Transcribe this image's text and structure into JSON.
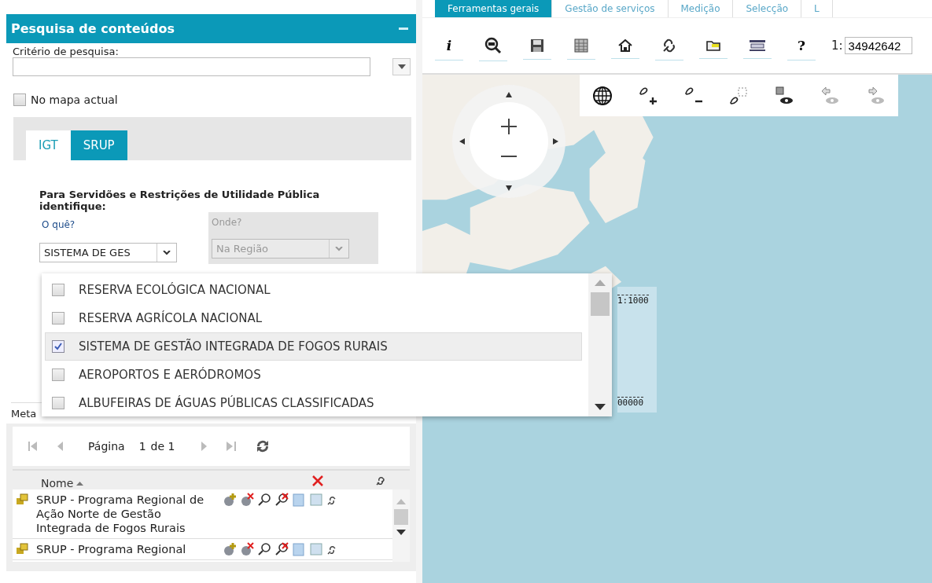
{
  "top_tabs": [
    {
      "label": "Ferramentas gerais",
      "selected": true
    },
    {
      "label": "Gestão de serviços",
      "selected": false
    },
    {
      "label": "Medição",
      "selected": false
    },
    {
      "label": "Selecção",
      "selected": false
    },
    {
      "label": "L",
      "selected": false
    }
  ],
  "map_toolbar": {
    "info_label": "i",
    "help_label": "?",
    "scale_prefix": "1:",
    "scale_value": "34942642"
  },
  "map": {
    "kind": "picture",
    "scale_labels": [
      "1:1000",
      "00000"
    ]
  },
  "search_panel": {
    "title": "Pesquisa de conteúdos",
    "criteria_label": "Critério de pesquisa:",
    "current_map": {
      "label": "No mapa actual",
      "checked": false
    },
    "tabs": [
      {
        "label": "IGT",
        "selected": false
      },
      {
        "label": "SRUP",
        "selected": true
      }
    ],
    "prompt": "Para Servidões e Restrições de Utilidade Pública identifique:",
    "what": {
      "label": "O quê?",
      "value": "SISTEMA DE GES"
    },
    "where": {
      "label": "Onde?",
      "value": "Na Região",
      "disabled": true
    },
    "metadata_label": "Meta"
  },
  "dropdown": {
    "options": [
      {
        "label": "RESERVA ECOLÓGICA NACIONAL",
        "checked": false,
        "selected": false
      },
      {
        "label": "RESERVA AGRÍCOLA NACIONAL",
        "checked": false,
        "selected": false
      },
      {
        "label": "SISTEMA DE GESTÃO INTEGRADA DE FOGOS RURAIS",
        "checked": true,
        "selected": true
      },
      {
        "label": "AEROPORTOS E AERÓDROMOS",
        "checked": false,
        "selected": false
      },
      {
        "label": "ALBUFEIRAS DE ÁGUAS PÚBLICAS CLASSIFICADAS",
        "checked": false,
        "selected": false
      }
    ]
  },
  "results": {
    "pager": {
      "page_label": "Página",
      "page_value": "1",
      "of_label": "de 1"
    },
    "columns": [
      {
        "label": "Nome"
      }
    ],
    "rows": [
      {
        "name": "SRUP - Programa Regional de Ação Norte de Gestão Integrada de Fogos Rurais"
      },
      {
        "name": "SRUP - Programa Regional"
      }
    ]
  }
}
